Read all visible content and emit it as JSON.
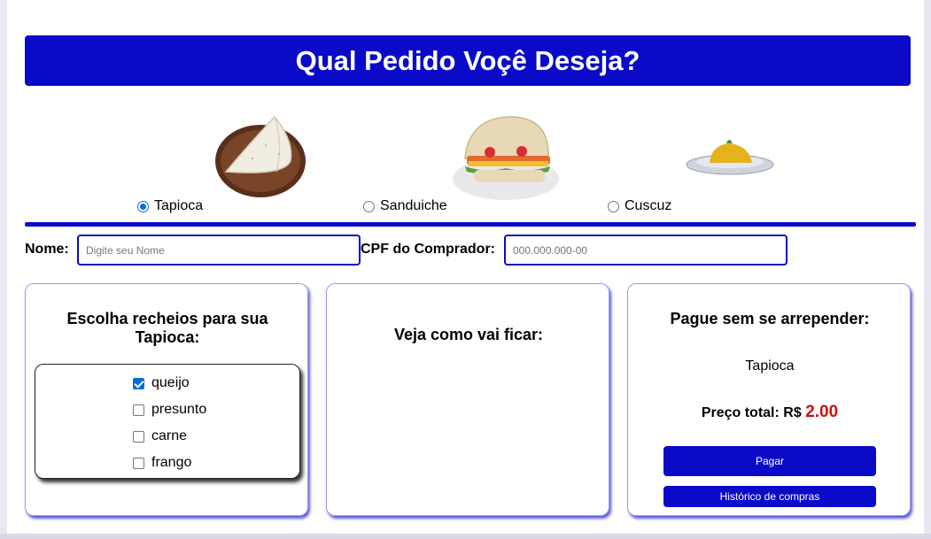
{
  "header": {
    "title": "Qual Pedido Voçê Deseja?"
  },
  "options": [
    {
      "label": "Tapioca",
      "selected": true,
      "icon": "tapioca-image"
    },
    {
      "label": "Sanduiche",
      "selected": false,
      "icon": "sandwich-image"
    },
    {
      "label": "Cuscuz",
      "selected": false,
      "icon": "cuscuz-image"
    }
  ],
  "form": {
    "name_label": "Nome:",
    "name_placeholder": "Digite seu Nome",
    "cpf_label": "CPF do Comprador:",
    "cpf_placeholder": "000.000.000-00"
  },
  "fillings": {
    "title": "Escolha recheios para sua Tapioca:",
    "items": [
      {
        "label": "queijo",
        "checked": true
      },
      {
        "label": "presunto",
        "checked": false
      },
      {
        "label": "carne",
        "checked": false
      },
      {
        "label": "frango",
        "checked": false
      }
    ]
  },
  "preview": {
    "title": "Veja como vai ficar:"
  },
  "payment": {
    "title": "Pague sem se arrepender:",
    "item": "Tapioca",
    "total_label": "Preço total: R$",
    "total_value": "2.00",
    "pay_button": "Pagar",
    "history_button": "Histórico de compras"
  },
  "colors": {
    "accent": "#0a0ac8",
    "price": "#d01010"
  }
}
